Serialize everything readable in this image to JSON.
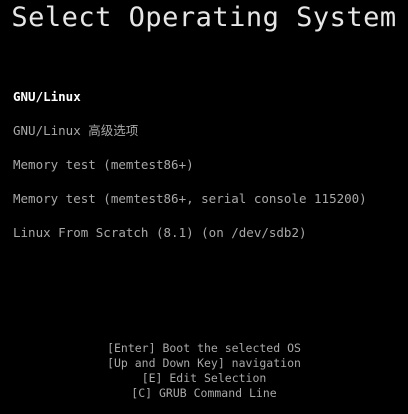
{
  "title": "Select Operating System",
  "menu": {
    "selected_index": 0,
    "entries": [
      {
        "label": "GNU/Linux"
      },
      {
        "label": "GNU/Linux 高级选项"
      },
      {
        "label": "Memory test (memtest86+)"
      },
      {
        "label": "Memory test (memtest86+, serial console 115200)"
      },
      {
        "label": "Linux From Scratch (8.1) (on /dev/sdb2)"
      }
    ]
  },
  "help": {
    "enter": "[Enter] Boot the selected OS",
    "updown": "[Up and Down Key] navigation",
    "edit": "[E] Edit Selection",
    "cmdline": "[C] GRUB Command Line"
  },
  "colors": {
    "background": "#000000",
    "title": "#e6e6e6",
    "selected": "#ffffff",
    "normal": "#a8a8a8"
  }
}
